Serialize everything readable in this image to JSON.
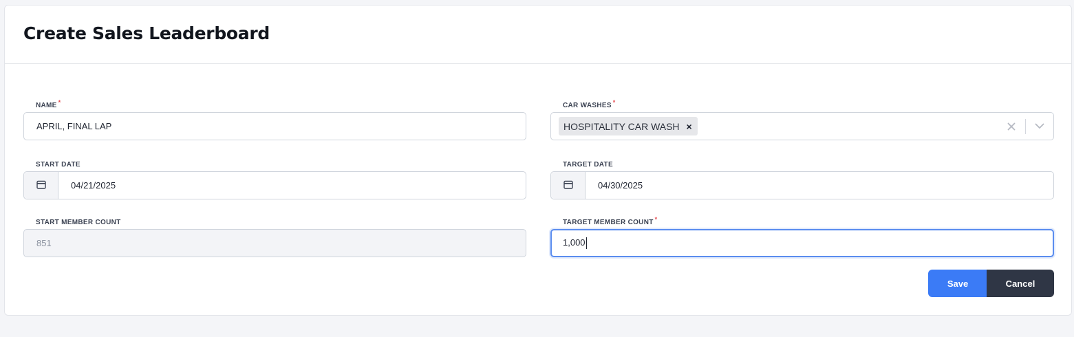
{
  "title": "Create Sales Leaderboard",
  "fields": {
    "name": {
      "label": "NAME",
      "required": true,
      "value": "APRIL, FINAL LAP"
    },
    "car_washes": {
      "label": "CAR WASHES",
      "required": true,
      "selected": [
        "HOSPITALITY CAR WASH"
      ],
      "tag_remove": "×"
    },
    "start_date": {
      "label": "START DATE",
      "value": "04/21/2025",
      "icon": "calendar-icon"
    },
    "target_date": {
      "label": "TARGET DATE",
      "value": "04/30/2025",
      "icon": "calendar-icon"
    },
    "start_member_count": {
      "label": "START MEMBER COUNT",
      "value": "851",
      "disabled": true
    },
    "target_member_count": {
      "label": "TARGET MEMBER COUNT",
      "required": true,
      "value": "1,000",
      "focused": true
    }
  },
  "required_marker": "*",
  "actions": {
    "save_label": "Save",
    "cancel_label": "Cancel"
  },
  "colors": {
    "primary": "#3b7bf6",
    "secondary": "#2f3645",
    "required": "#e5484d",
    "focus": "#5b8def"
  }
}
